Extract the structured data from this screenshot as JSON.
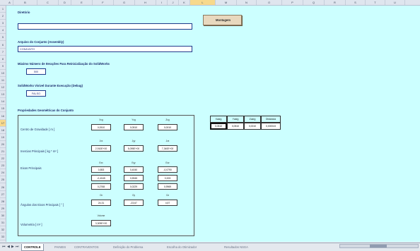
{
  "columns": [
    "A",
    "B",
    "C",
    "D",
    "E",
    "F",
    "G",
    "H",
    "I",
    "J",
    "K",
    "L",
    "M",
    "N",
    "O",
    "P",
    "Q",
    "R",
    "S",
    "T",
    "U"
  ],
  "selected_column": "L",
  "rows": [
    "1",
    "2",
    "3",
    "4",
    "5",
    "6",
    "7",
    "8",
    "9",
    "10",
    "11",
    "12",
    "13",
    "14",
    "15",
    "16",
    "17",
    "18",
    "19",
    "20",
    "21",
    "22",
    "23",
    "24",
    "25",
    "26",
    "27",
    "28",
    "29",
    "30",
    "31",
    "32",
    "33"
  ],
  "selected_row": "17",
  "directory": {
    "label": "Diretório",
    "value": ""
  },
  "assembly": {
    "label": "Arquivo do Conjunto (Assembly)",
    "value": "CONJUNTO"
  },
  "max_iter": {
    "label": "Máximo Número de Iterações Para Reinicialização do SolidWorks",
    "value": "500"
  },
  "visible": {
    "label": "SolidWorks Visível Durante Execução (Debug)",
    "value": "FALSO"
  },
  "montagem_button": "Montagem",
  "props": {
    "title": "Propriedades Geométricas do Conjunto",
    "cg": {
      "label": "Centro de Gravidade [ m ]",
      "headers": [
        "Xcg",
        "Ycg",
        "Zcg"
      ],
      "values": [
        "0,0510",
        "0,0510",
        "0,0010"
      ]
    },
    "inertia": {
      "label": "Inercias Principais [ kg * m² ]",
      "headers": [
        "Jxx",
        "Jyy",
        "Jzz"
      ],
      "values": [
        "2,910E+00",
        "5,095E+00",
        "7,340E+00"
      ]
    },
    "axes": {
      "label": "Eixos Principais",
      "headers": [
        "Exx",
        "Eyy",
        "Ezz"
      ],
      "rows": [
        [
          "0,853",
          "0,4040",
          "-0,0790"
        ],
        [
          "-0,4045",
          "0,5945",
          "0,003"
        ],
        [
          "0,2768",
          "0,0229",
          "0,9969"
        ]
      ]
    },
    "angles": {
      "label": "Ângulos dos Eixos Principais [ ° ]",
      "headers": [
        "Ox",
        "Oy",
        "Oz"
      ],
      "values": [
        "24,31",
        "-23,67",
        "4,57"
      ]
    },
    "volume": {
      "label": "Volumetria [ m³ ]",
      "header": "Volume",
      "value": "3,309E+00"
    }
  },
  "cg_table": {
    "headers": [
      "Xcarg",
      "Ycarg",
      "Zcarg",
      "Distancia"
    ],
    "values": [
      "0,0510",
      "0,0510",
      "0,0010",
      "0,000043"
    ]
  },
  "tabs": {
    "nav": [
      "⏮",
      "◀",
      "▶",
      "⏭"
    ],
    "items": [
      "CONTROLE",
      "PAINEIS",
      "CONTRAVENTOS",
      "Definição do Problema",
      "Escolha do Otimizador",
      "Resultados NSGA"
    ],
    "active": "CONTROLE"
  }
}
